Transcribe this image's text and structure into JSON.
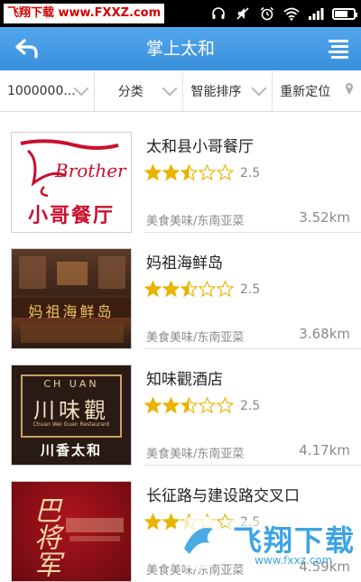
{
  "status_bar": {
    "watermark_text": "飞翔下载 www.FXXZ.com",
    "icons": [
      "headset-icon",
      "mute-icon",
      "alarm-icon",
      "wifi-icon",
      "signal-icon",
      "battery-icon"
    ],
    "battery_level": 0.7
  },
  "header": {
    "title": "掌上太和",
    "back_icon": "back-arrow-icon",
    "menu_icon": "menu-icon"
  },
  "filters": [
    {
      "label": "1000000...",
      "icon": "chevron-down-icon"
    },
    {
      "label": "分类",
      "icon": "chevron-down-icon"
    },
    {
      "label": "智能排序",
      "icon": "chevron-down-icon"
    },
    {
      "label": "重新定位",
      "icon": "location-pin-icon"
    }
  ],
  "listings": [
    {
      "name": "太和县小哥餐厅",
      "rating": 2.5,
      "rating_text": "2.5",
      "category": "美食美味/东南亚菜",
      "distance": "3.52km",
      "thumb_text_main": "小哥餐厅",
      "thumb_text_script": "Brother"
    },
    {
      "name": "妈祖海鲜岛",
      "rating": 2.5,
      "rating_text": "2.5",
      "category": "美食美味/东南亚菜",
      "distance": "3.68km",
      "thumb_text_main": "妈祖海鲜岛"
    },
    {
      "name": "知味觀酒店",
      "rating": 2.5,
      "rating_text": "2.5",
      "category": "美食美味/东南亚菜",
      "distance": "4.17km",
      "thumb_text_top": "CH UAN",
      "thumb_text_main": "川味觀",
      "thumb_text_sub": "Chuan Wei Guan Restaurant",
      "thumb_text_bottom": "川香太和"
    },
    {
      "name": "长征路与建设路交叉口",
      "rating": 2.5,
      "rating_text": "2.5",
      "category": "美食美味/东南亚菜",
      "distance": "4.59km",
      "thumb_text_main": "巴将军"
    }
  ],
  "bottom_watermark": {
    "text": "飞翔下载",
    "url": "www.fxxz.com"
  },
  "colors": {
    "header_blue": "#3f95e0",
    "star_gold": "#e8b400",
    "text_dark": "#222222",
    "text_grey": "#8a8a8a"
  }
}
